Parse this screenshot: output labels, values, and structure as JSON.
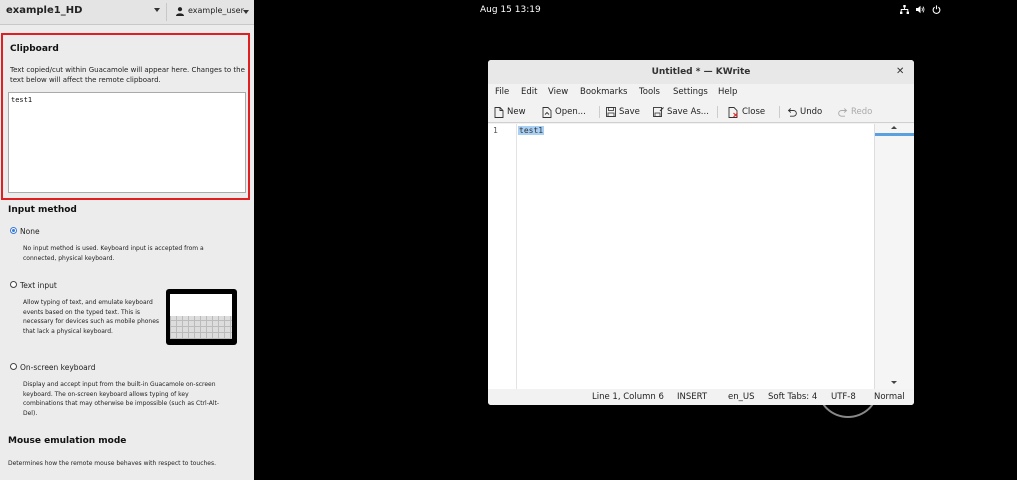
{
  "panel": {
    "connection_name": "example1_HD",
    "username": "example_user",
    "clipboard": {
      "title": "Clipboard",
      "description": "Text copied/cut within Guacamole will appear here. Changes to the text below will affect the remote clipboard.",
      "content": "test1"
    },
    "input_method": {
      "title": "Input method",
      "options": [
        {
          "label": "None",
          "selected": true,
          "description": "No input method is used. Keyboard input is accepted from a connected, physical keyboard."
        },
        {
          "label": "Text input",
          "selected": false,
          "description": "Allow typing of text, and emulate keyboard events based on the typed text. This is necessary for devices such as mobile phones that lack a physical keyboard."
        },
        {
          "label": "On-screen keyboard",
          "selected": false,
          "description": "Display and accept input from the built-in Guacamole on-screen keyboard. The on-screen keyboard allows typing of key combinations that may otherwise be impossible (such as Ctrl-Alt-Del)."
        }
      ]
    },
    "mouse_emulation": {
      "title": "Mouse emulation mode",
      "description": "Determines how the remote mouse behaves with respect to touches."
    }
  },
  "topbar": {
    "clock": "Aug 15  13:19",
    "tray_icons": [
      "network-icon",
      "volume-icon",
      "power-icon"
    ]
  },
  "kwrite": {
    "title": "Untitled * — KWrite",
    "menu": [
      "File",
      "Edit",
      "View",
      "Bookmarks",
      "Tools",
      "Settings",
      "Help"
    ],
    "toolbar": {
      "new": "New",
      "open": "Open...",
      "save": "Save",
      "save_as": "Save As...",
      "close": "Close",
      "undo": "Undo",
      "redo": "Redo"
    },
    "editor": {
      "line_number": "1",
      "text": "test1"
    },
    "status": {
      "position": "Line 1, Column 6",
      "mode": "INSERT",
      "language": "en_US",
      "indent": "Soft Tabs: 4",
      "encoding": "UTF-8",
      "highlighting": "Normal"
    }
  },
  "colors": {
    "clipboard_highlight": "#e02020",
    "selection": "#a8d0f5",
    "radio_selected": "#3a7bd5"
  }
}
